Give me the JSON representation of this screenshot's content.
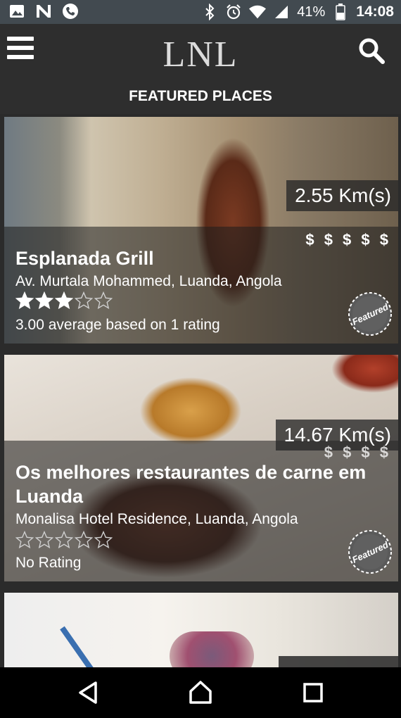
{
  "status_bar": {
    "battery_percent": "41%",
    "time": "14:08",
    "icons": [
      "image-icon",
      "n-icon",
      "phone-icon",
      "bluetooth-icon",
      "alarm-icon",
      "wifi-icon",
      "signal-icon",
      "battery-icon"
    ]
  },
  "app_bar": {
    "logo_text": "LNL",
    "icons": [
      "menu-icon",
      "search-icon"
    ]
  },
  "section": {
    "title": "FEATURED PLACES"
  },
  "places": [
    {
      "distance": "2.55 Km(s)",
      "price": "$ $ $ $ $",
      "name": "Esplanada Grill",
      "address": "Av. Murtala Mohammed, Luanda, Angola",
      "rating_value": 3,
      "rating_max": 5,
      "rating_text": "3.00 average based on 1 rating",
      "badge": "Featured"
    },
    {
      "distance": "14.67 Km(s)",
      "price": "$ $ $ $",
      "name": "Os melhores restaurantes de carne em Luanda",
      "address": "Monalisa Hotel Residence, Luanda, Angola",
      "rating_value": 0,
      "rating_max": 5,
      "rating_text": "No Rating",
      "badge": "Featured"
    }
  ],
  "nav_bar": {
    "icons": [
      "back-icon",
      "home-icon",
      "recents-icon"
    ]
  },
  "colors": {
    "status_bar": "#424a50",
    "app_bar": "#2e2e2e",
    "background": "#2b2b2b",
    "nav_bar": "#000000"
  }
}
